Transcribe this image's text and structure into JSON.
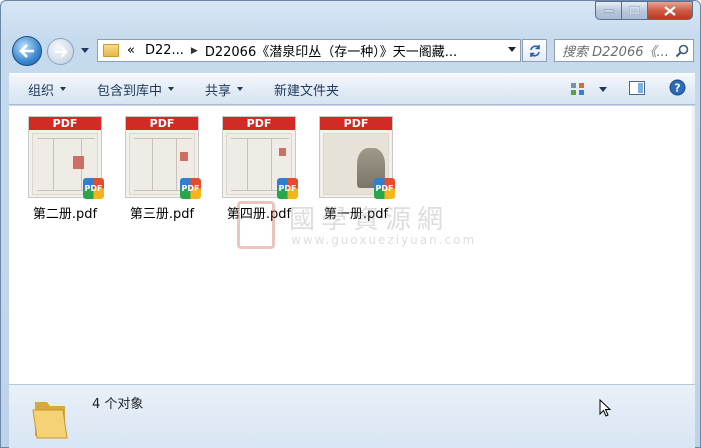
{
  "window": {
    "caption_buttons": [
      "minimize",
      "maximize",
      "close"
    ]
  },
  "address": {
    "prefix": "«",
    "segments": [
      "D22...",
      "D22066《潜泉印丛（存一种）》天一阁藏..."
    ],
    "search_placeholder": "搜索 D22066《..."
  },
  "toolbar": {
    "organize": "组织",
    "include_library": "包含到库中",
    "share": "共享",
    "new_folder": "新建文件夹"
  },
  "files": [
    {
      "name": "第二册.pdf",
      "band": "PDF",
      "badge": "PDF"
    },
    {
      "name": "第三册.pdf",
      "band": "PDF",
      "badge": "PDF"
    },
    {
      "name": "第四册.pdf",
      "band": "PDF",
      "badge": "PDF"
    },
    {
      "name": "第一册.pdf",
      "band": "PDF",
      "badge": "PDF"
    }
  ],
  "watermark": {
    "title": "國學資源網",
    "url": "www.guoxueziyuan.com"
  },
  "status": {
    "count": "4 个对象"
  },
  "colors": {
    "pdf_band": "#d22a24",
    "toolbar_text": "#1e395b",
    "close_button": "#cf5a44"
  }
}
